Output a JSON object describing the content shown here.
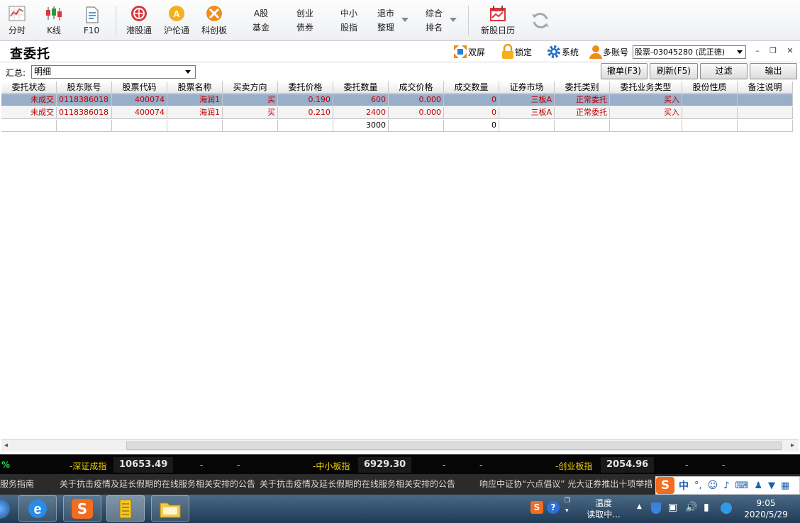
{
  "toolbar": {
    "items": [
      {
        "label": "分时",
        "icon": "time-chart-icon"
      },
      {
        "label": "K线",
        "icon": "kline-icon"
      },
      {
        "label": "F10",
        "icon": "f10-doc-icon"
      },
      {
        "label": "港股通",
        "icon": "hk-connect-icon"
      },
      {
        "label": "沪伦通",
        "icon": "sh-london-icon"
      },
      {
        "label": "科创板",
        "icon": "star-market-icon"
      },
      {
        "line1": "A股",
        "line2": "基金"
      },
      {
        "line1": "创业",
        "line2": "债券"
      },
      {
        "line1": "中小",
        "line2": "股指"
      },
      {
        "line1": "退市",
        "line2": "整理"
      },
      {
        "line1": "综合",
        "line2": "排名"
      },
      {
        "label": "新股日历",
        "icon": "ipo-calendar-icon"
      }
    ],
    "colors": {
      "red_icon": "#d9363e",
      "orange_icon": "#f08c1a"
    }
  },
  "header": {
    "title": "查委托",
    "dual_screen": "双屏",
    "lock": "锁定",
    "system": "系统",
    "multi_account": "多账号",
    "account_value": "股票-03045280 (武正德)"
  },
  "filter": {
    "label": "汇总:",
    "value": "明细",
    "buttons": {
      "cancel": "撤单(F3)",
      "refresh": "刷新(F5)",
      "filter": "过滤",
      "export": "输出"
    }
  },
  "table": {
    "columns": [
      "委托状态",
      "股东账号",
      "股票代码",
      "股票名称",
      "买卖方向",
      "委托价格",
      "委托数量",
      "成交价格",
      "成交数量",
      "证券市场",
      "委托类别",
      "委托业务类型",
      "股份性质",
      "备注说明"
    ],
    "rows": [
      [
        "未成交",
        "0118386018",
        "400074",
        "海润1",
        "买",
        "0.190",
        "600",
        "0.000",
        "0",
        "三板A",
        "正常委托",
        "买入",
        "",
        ""
      ],
      [
        "未成交",
        "0118386018",
        "400074",
        "海润1",
        "买",
        "0.210",
        "2400",
        "0.000",
        "0",
        "三板A",
        "正常委托",
        "买入",
        "",
        ""
      ]
    ],
    "totals": [
      "",
      "",
      "",
      "",
      "",
      "",
      "3000",
      "",
      "0",
      "",
      "",
      "",
      "",
      ""
    ],
    "selected_row": 0
  },
  "ticker": {
    "lead": "%",
    "items": [
      {
        "name": "深证成指",
        "value": "10653.49",
        "d1": "-",
        "d2": "-"
      },
      {
        "name": "中小板指",
        "value": "6929.30",
        "d1": "-",
        "d2": "-"
      },
      {
        "name": "创业板指",
        "value": "2054.96",
        "d1": "-",
        "d2": "-"
      }
    ]
  },
  "notice": {
    "items": [
      "服务指南",
      "关于抗击疫情及延长假期的在线服务相关安排的公告",
      "关于抗击疫情及延长假期的在线服务相关安排的公告",
      "响应中证协“六点倡议” 光大证券推出十项举措"
    ]
  },
  "ime": {
    "mode": "中"
  },
  "taskbar": {
    "weather_title": "温度",
    "weather_status": "读取中...",
    "time": "9:05",
    "date": "2020/5/29"
  }
}
